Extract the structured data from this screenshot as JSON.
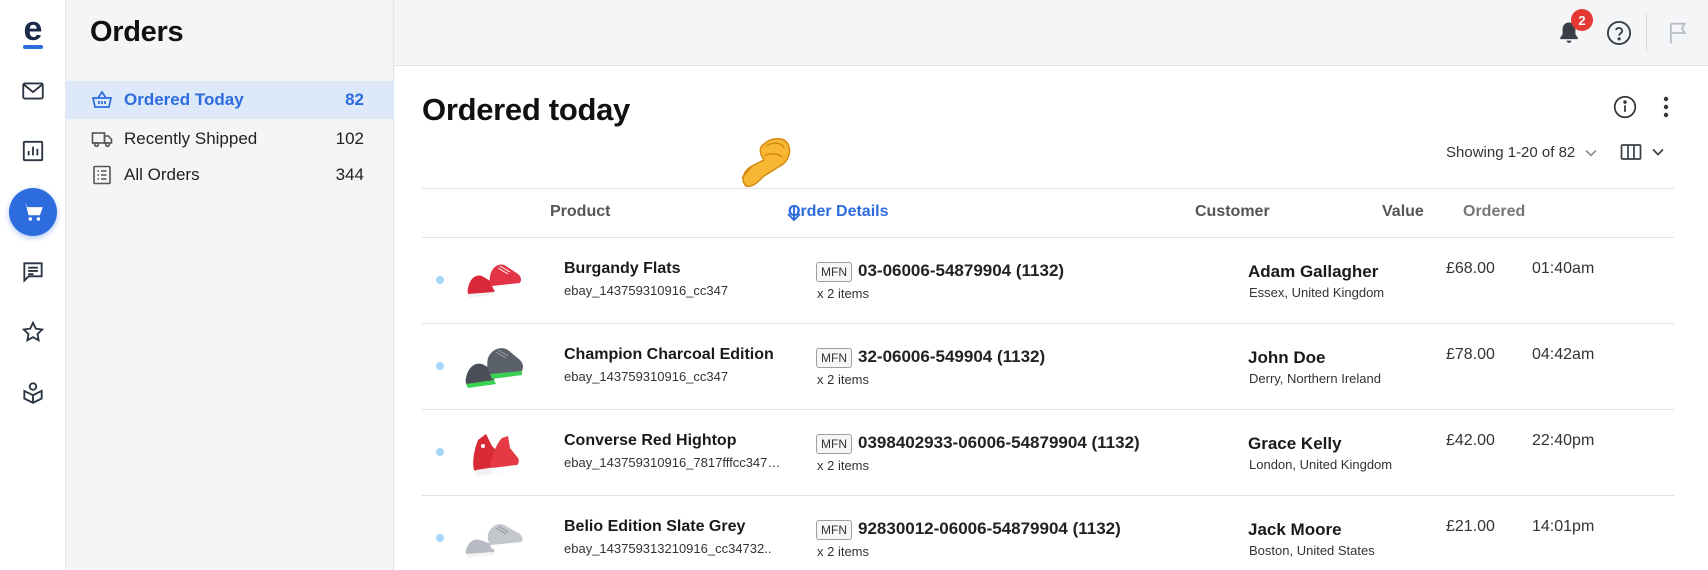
{
  "rail": {
    "logo_letter": "e",
    "items": [
      {
        "icon": "mail-icon"
      },
      {
        "icon": "chart-icon"
      },
      {
        "icon": "cart-icon"
      },
      {
        "icon": "message-icon"
      },
      {
        "icon": "star-icon"
      },
      {
        "icon": "box-user-icon"
      }
    ]
  },
  "sidebar": {
    "title": "Orders",
    "items": [
      {
        "label": "Ordered Today",
        "count": "82",
        "icon": "basket-icon"
      },
      {
        "label": "Recently Shipped",
        "count": "102",
        "icon": "truck-icon"
      },
      {
        "label": "All Orders",
        "count": "344",
        "icon": "list-icon"
      }
    ]
  },
  "topbar": {
    "notifications_count": "2"
  },
  "main": {
    "title": "Ordered today",
    "pager_text": "Showing 1-20 of 82"
  },
  "table": {
    "headers": {
      "product": "Product",
      "order_details": "Order Details",
      "customer": "Customer",
      "value": "Value",
      "ordered": "Ordered"
    },
    "rows": [
      {
        "product": "Burgandy Flats",
        "sku": "ebay_143759310916_cc347",
        "channel": "MFN",
        "order_no": "03-06006-54879904 (1132)",
        "items": "x 2 items",
        "customer": "Adam Gallagher",
        "location": "Essex, United Kingdom",
        "value": "£68.00",
        "ordered": "01:40am",
        "thumb": "red-sneakers"
      },
      {
        "product": "Champion Charcoal Edition",
        "sku": "ebay_143759310916_cc347",
        "channel": "MFN",
        "order_no": "32-06006-549904 (1132)",
        "items": "x 2 items",
        "customer": "John Doe",
        "location": "Derry, Northern Ireland",
        "value": "£78.00",
        "ordered": "04:42am",
        "thumb": "grey-green-sneakers"
      },
      {
        "product": "Converse Red Hightop",
        "sku": "ebay_143759310916_7817fffcc34731..",
        "channel": "MFN",
        "order_no": "0398402933-06006-54879904 (1132)",
        "items": "x 2 items",
        "customer": "Grace Kelly",
        "location": "London, United Kingdom",
        "value": "£42.00",
        "ordered": "22:40pm",
        "thumb": "red-hightop"
      },
      {
        "product": "Belio Edition Slate Grey",
        "sku": "ebay_143759313210916_cc34732..",
        "channel": "MFN",
        "order_no": "92830012-06006-54879904 (1132)",
        "items": "x 2 items",
        "customer": "Jack Moore",
        "location": "Boston, United States",
        "value": "£21.00",
        "ordered": "14:01pm",
        "thumb": "grey-sneakers"
      }
    ]
  },
  "colors": {
    "accent": "#2d6cdf",
    "badge": "#e53935",
    "sidebar_bg": "#f4f5f7",
    "active_item_bg": "#dde8f8"
  }
}
